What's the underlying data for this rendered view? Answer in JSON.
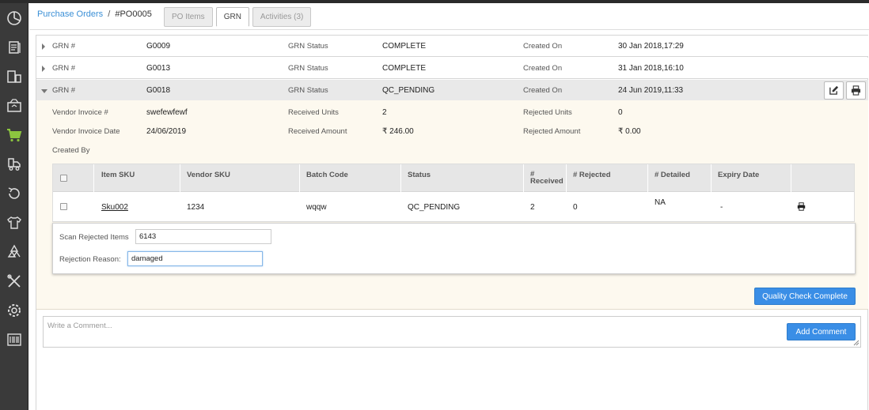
{
  "breadcrumb": {
    "parent": "Purchase Orders",
    "separator": "/",
    "current": "#PO0005"
  },
  "tabs": [
    {
      "label": "PO Items",
      "active": false
    },
    {
      "label": "GRN",
      "active": true
    },
    {
      "label": "Activities (3)",
      "active": false
    }
  ],
  "sidebar_icons": [
    "dashboard-icon",
    "orders-icon",
    "catalog-icon",
    "inventory-icon",
    "purchase-cart-icon",
    "shipping-icon",
    "returns-icon",
    "apparel-icon",
    "recycle-icon",
    "tools-icon",
    "settings-icon",
    "barcode-icon"
  ],
  "grns": [
    {
      "grn_label": "GRN #",
      "grn": "G0009",
      "status_label": "GRN Status",
      "status": "COMPLETE",
      "created_label": "Created On",
      "created": "30 Jan 2018,17:29"
    },
    {
      "grn_label": "GRN #",
      "grn": "G0013",
      "status_label": "GRN Status",
      "status": "COMPLETE",
      "created_label": "Created On",
      "created": "31 Jan 2018,16:10"
    },
    {
      "grn_label": "GRN #",
      "grn": "G0018",
      "status_label": "GRN Status",
      "status": "QC_PENDING",
      "created_label": "Created On",
      "created": "24 Jun 2019,11:33"
    }
  ],
  "detail": {
    "vendor_invoice_label": "Vendor Invoice #",
    "vendor_invoice": "swefewfewf",
    "received_units_label": "Received Units",
    "received_units": "2",
    "rejected_units_label": "Rejected Units",
    "rejected_units": "0",
    "vendor_invoice_date_label": "Vendor Invoice Date",
    "vendor_invoice_date": "24/06/2019",
    "received_amount_label": "Received Amount",
    "received_amount": "₹ 246.00",
    "rejected_amount_label": "Rejected Amount",
    "rejected_amount": "₹ 0.00",
    "created_by_label": "Created By"
  },
  "table": {
    "headers": {
      "item_sku": "Item SKU",
      "vendor_sku": "Vendor SKU",
      "batch_code": "Batch Code",
      "status": "Status",
      "received_1": "#",
      "received_2": "Received",
      "rejected": "# Rejected",
      "detailed": "# Detailed",
      "expiry": "Expiry Date"
    },
    "row": {
      "item_sku": "Sku002",
      "vendor_sku": "1234",
      "batch_code": "wqqw",
      "status": "QC_PENDING",
      "received": "2",
      "rejected": "0",
      "detailed": "NA",
      "expiry": "-"
    }
  },
  "reject": {
    "scan_label": "Scan Rejected Items",
    "scan_value": "6143",
    "reason_label": "Rejection Reason:",
    "reason_value": "damaged"
  },
  "buttons": {
    "qc_complete": "Quality Check Complete",
    "add_comment": "Add Comment"
  },
  "comment": {
    "placeholder": "Write a Comment..."
  },
  "colors": {
    "accent": "#3a8ee6",
    "link": "#3a8fd6",
    "sidebar": "#3a3a3a",
    "active_nav": "#8cc63f",
    "detail_bg": "#fdf9ef"
  }
}
